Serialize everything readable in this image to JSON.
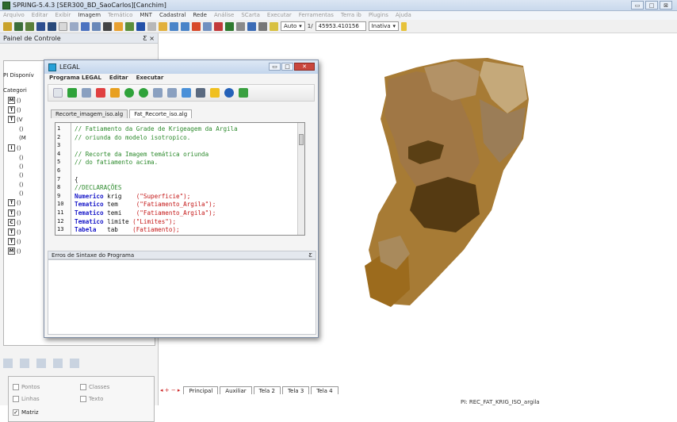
{
  "app": {
    "title": "SPRING-5.4.3 [SER300_BD_SaoCarlos][Canchim]",
    "controls": [
      "▭",
      "□",
      "⊠"
    ]
  },
  "menu": [
    "Arquivo",
    "Editar",
    "Exibir",
    "Imagem",
    "Temático",
    "MNT",
    "Cadastral",
    "Rede",
    "Análise",
    "SCarta",
    "Executar",
    "Ferramentas",
    "Terra ib",
    "Plugins",
    "Ajuda"
  ],
  "toolbar": {
    "auto": "Auto",
    "scale_prefix": "1/",
    "scale": "45953.410156",
    "inativa": "Inativa"
  },
  "panel": {
    "title": "Painel de Controle",
    "pin": "Ƹ ×",
    "pi": "PI Disponív",
    "categories": "Categori",
    "tree": [
      {
        "icon": "M",
        "label": "()"
      },
      {
        "icon": "T",
        "label": "()"
      },
      {
        "icon": "T",
        "label": "(V"
      },
      {
        "icon": "",
        "label": "()"
      },
      {
        "icon": "",
        "label": "(M"
      },
      {
        "icon": "I",
        "label": "()"
      },
      {
        "icon": "",
        "label": "()"
      },
      {
        "icon": "",
        "label": "()"
      },
      {
        "icon": "",
        "label": "()"
      },
      {
        "icon": "",
        "label": "()"
      },
      {
        "icon": "",
        "label": "()"
      },
      {
        "icon": "T",
        "label": "()"
      },
      {
        "icon": "T",
        "label": "()"
      },
      {
        "icon": "C",
        "label": "()"
      },
      {
        "icon": "T",
        "label": "()"
      },
      {
        "icon": "T",
        "label": "()"
      },
      {
        "icon": "M",
        "label": "()"
      }
    ],
    "checks": [
      {
        "label": "Pontos",
        "on": false
      },
      {
        "label": "Classes",
        "on": false
      },
      {
        "label": "Linhas",
        "on": false
      },
      {
        "label": "Texto",
        "on": false
      },
      {
        "label": "Matriz",
        "on": true
      }
    ]
  },
  "legal": {
    "title": "LEGAL",
    "menu": [
      "Programa LEGAL",
      "Editar",
      "Executar"
    ],
    "tabs": [
      "Recorte_imagem_iso.alg",
      "Fat_Recorte_iso.alg"
    ],
    "err_title": "Erros de Sintaxe do Programa",
    "err_pin": "Ƹ",
    "lines": [
      "1",
      "2",
      "3",
      "4",
      "5",
      "6",
      "7",
      "8",
      "9",
      "10",
      "11",
      "12",
      "13"
    ],
    "code": [
      [
        {
          "t": "// Fatiamento da Grade de Krigeagem da Argila",
          "c": "cmt"
        }
      ],
      [
        {
          "t": "// oriunda do modelo isotropico.",
          "c": "cmt"
        }
      ],
      [],
      [
        {
          "t": "// Recorte da Imagem temática oriunda",
          "c": "cmt"
        }
      ],
      [
        {
          "t": "// do fatiamento acima.",
          "c": "cmt"
        }
      ],
      [],
      [
        {
          "t": "{",
          "c": "plain"
        }
      ],
      [
        {
          "t": "//DECLARAÇÕES",
          "c": "cmt"
        }
      ],
      [
        {
          "t": "Numerico",
          "c": "kw"
        },
        {
          "t": " krig    ",
          "c": "plain"
        },
        {
          "t": "(\"Superficie\");",
          "c": "str"
        }
      ],
      [
        {
          "t": "Tematico",
          "c": "kw"
        },
        {
          "t": " tem     ",
          "c": "plain"
        },
        {
          "t": "(\"Fatiamento_Argila\");",
          "c": "str"
        }
      ],
      [
        {
          "t": "Tematico",
          "c": "kw"
        },
        {
          "t": " temi    ",
          "c": "plain"
        },
        {
          "t": "(\"Fatiamento_Argila\");",
          "c": "str"
        }
      ],
      [
        {
          "t": "Tematico",
          "c": "kw"
        },
        {
          "t": " limite ",
          "c": "plain"
        },
        {
          "t": "(\"Limites\");",
          "c": "str"
        }
      ],
      [
        {
          "t": "Tabela",
          "c": "kw"
        },
        {
          "t": "   tab    ",
          "c": "plain"
        },
        {
          "t": "(Fatiamento);",
          "c": "str"
        }
      ]
    ]
  },
  "tabs": [
    "Principal",
    "Auxiliar",
    "Tela 2",
    "Tela 3",
    "Tela 4"
  ],
  "status": "PI: REC_FAT_KRIG_ISO_argila"
}
